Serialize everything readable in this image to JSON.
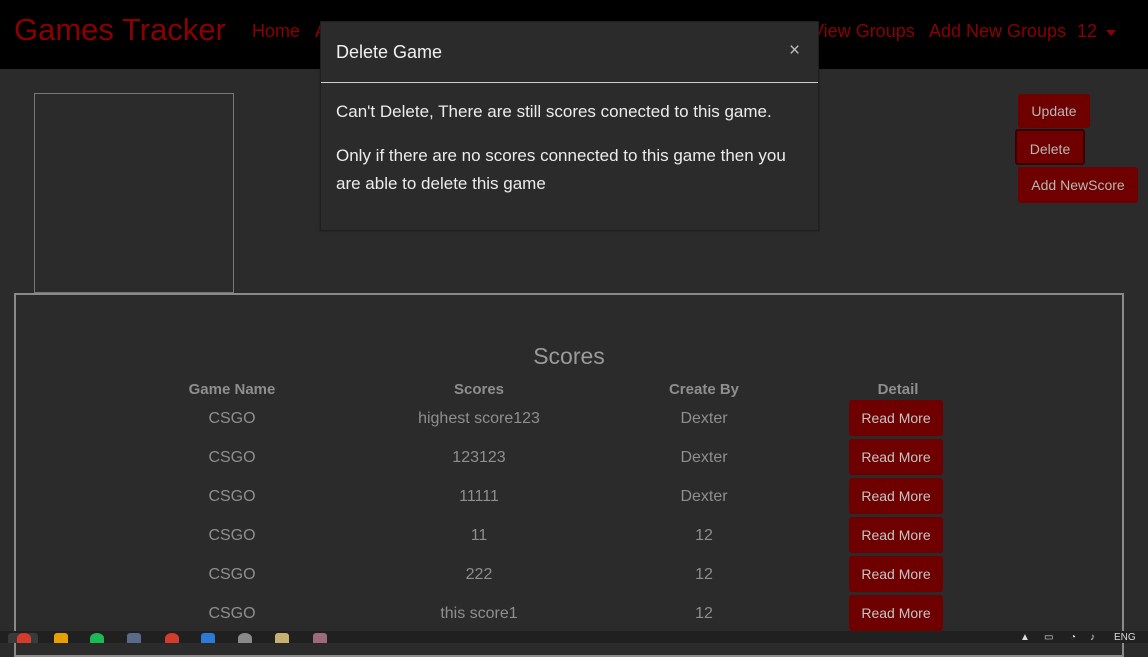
{
  "app": {
    "brand": "Games Tracker"
  },
  "nav": {
    "home": "Home",
    "hidden_a": "A",
    "view_groups": "View Groups",
    "add_new_groups": "Add New Groups",
    "user": "12"
  },
  "actions": {
    "update": "Update",
    "delete": "Delete",
    "add_new_score": "Add NewScore"
  },
  "scores": {
    "title": "Scores",
    "headers": [
      "Game Name",
      "Scores",
      "Create By",
      "Detail"
    ],
    "read_more": "Read More",
    "rows": [
      {
        "game": "CSGO",
        "score": "highest score123",
        "by": "Dexter"
      },
      {
        "game": "CSGO",
        "score": "123123",
        "by": "Dexter"
      },
      {
        "game": "CSGO",
        "score": "11111",
        "by": "Dexter"
      },
      {
        "game": "CSGO",
        "score": "11",
        "by": "12"
      },
      {
        "game": "CSGO",
        "score": "222",
        "by": "12"
      },
      {
        "game": "CSGO",
        "score": "this score1",
        "by": "12"
      }
    ]
  },
  "modal": {
    "title": "Delete Game",
    "close": "×",
    "message1": "Can't Delete, There are still scores conected to this game.",
    "message2": "Only if there are no scores connected to this game then you are able to delete this game"
  },
  "taskbar": {
    "lang": "ENG"
  },
  "colors": {
    "brand": "#8b0000",
    "button": "#6e0000",
    "background": "#2b2b2b",
    "navbar": "#000000"
  }
}
